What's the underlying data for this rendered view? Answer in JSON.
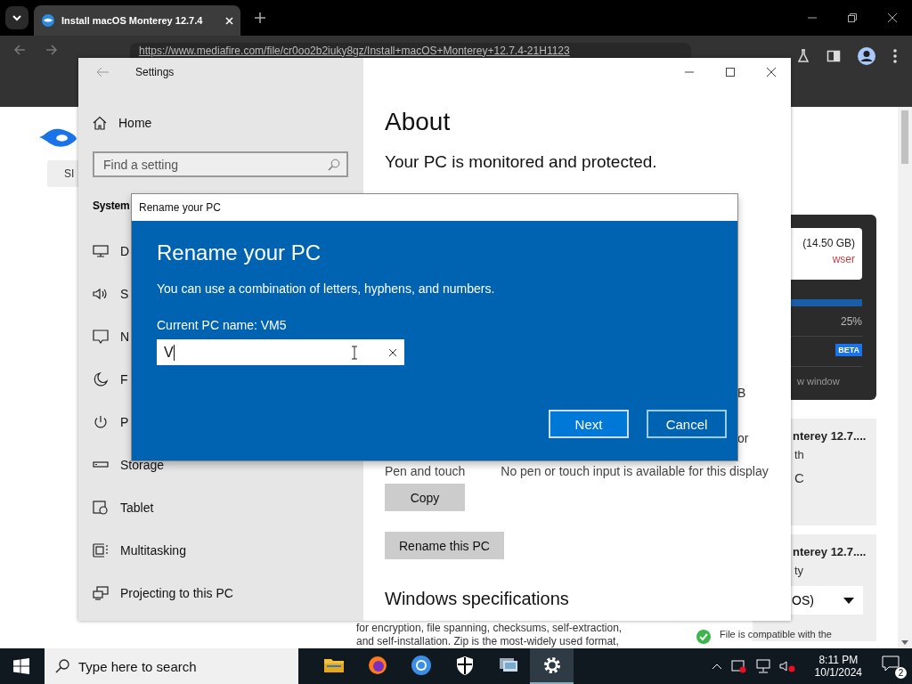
{
  "browser": {
    "tab_title": "Install macOS Monterey 12.7.4",
    "url": "https://www.mediafire.com/file/cr0oo2b2iuky8gz/Install+macOS+Monterey+12.7.4-21H1123",
    "page": {
      "sign_button": "SI",
      "size_text": "(14.50 GB)",
      "warning_text": "wser",
      "progress": {
        "level": 1,
        "reading": "25%"
      },
      "beta_badge": "BETA",
      "window_link": "w window",
      "cards": [
        {
          "title": "nterey 12.7....",
          "line_1": "th",
          "line_2": "C"
        },
        {
          "title": "nterey 12.7....",
          "line_1": "ty",
          "select": "OS)"
        }
      ],
      "compat_text": "File is compatible with the",
      "body_lines": [
        "for encryption, file spanning, checksums, self-extraction,",
        "and self-installation. Zip is the most-widely used format,"
      ]
    }
  },
  "settings": {
    "title": "Settings",
    "home": "Home",
    "search": {
      "placeholder": "Find a setting"
    },
    "section": "System",
    "items": [
      {
        "label": "D"
      },
      {
        "label": "S"
      },
      {
        "label": "N"
      },
      {
        "label": "F"
      },
      {
        "label": "P"
      },
      {
        "label": "Storage"
      },
      {
        "label": "Tablet"
      },
      {
        "label": "Multitasking"
      },
      {
        "label": "Projecting to this PC"
      }
    ],
    "heading": "About",
    "status": "Your PC is monitored and protected.",
    "fragments": [
      "B",
      "or"
    ],
    "spec_row": {
      "label": "Pen and touch",
      "value": "No pen or touch input is available for this display"
    },
    "buttons": [
      "Copy",
      "Rename this PC"
    ],
    "subheading": "Windows specifications"
  },
  "dialog": {
    "title": "Rename your PC",
    "heading": "Rename your PC",
    "hint": "You can use a combination of letters, hyphens, and numbers.",
    "current_name": "Current PC name: VM5",
    "name_value": "V",
    "buttons": [
      {
        "label": "Next",
        "selected": true
      },
      {
        "label": "Cancel",
        "selected": false
      }
    ]
  },
  "taskbar": {
    "search": {
      "placeholder": "Type here to search"
    },
    "apps": [
      {
        "active": false
      },
      {
        "active": false
      },
      {
        "active": false
      },
      {
        "active": false
      },
      {
        "active": false
      },
      {
        "active": true
      }
    ],
    "time": "8:11 PM",
    "date": "10/1/2024",
    "notifications": "2"
  }
}
